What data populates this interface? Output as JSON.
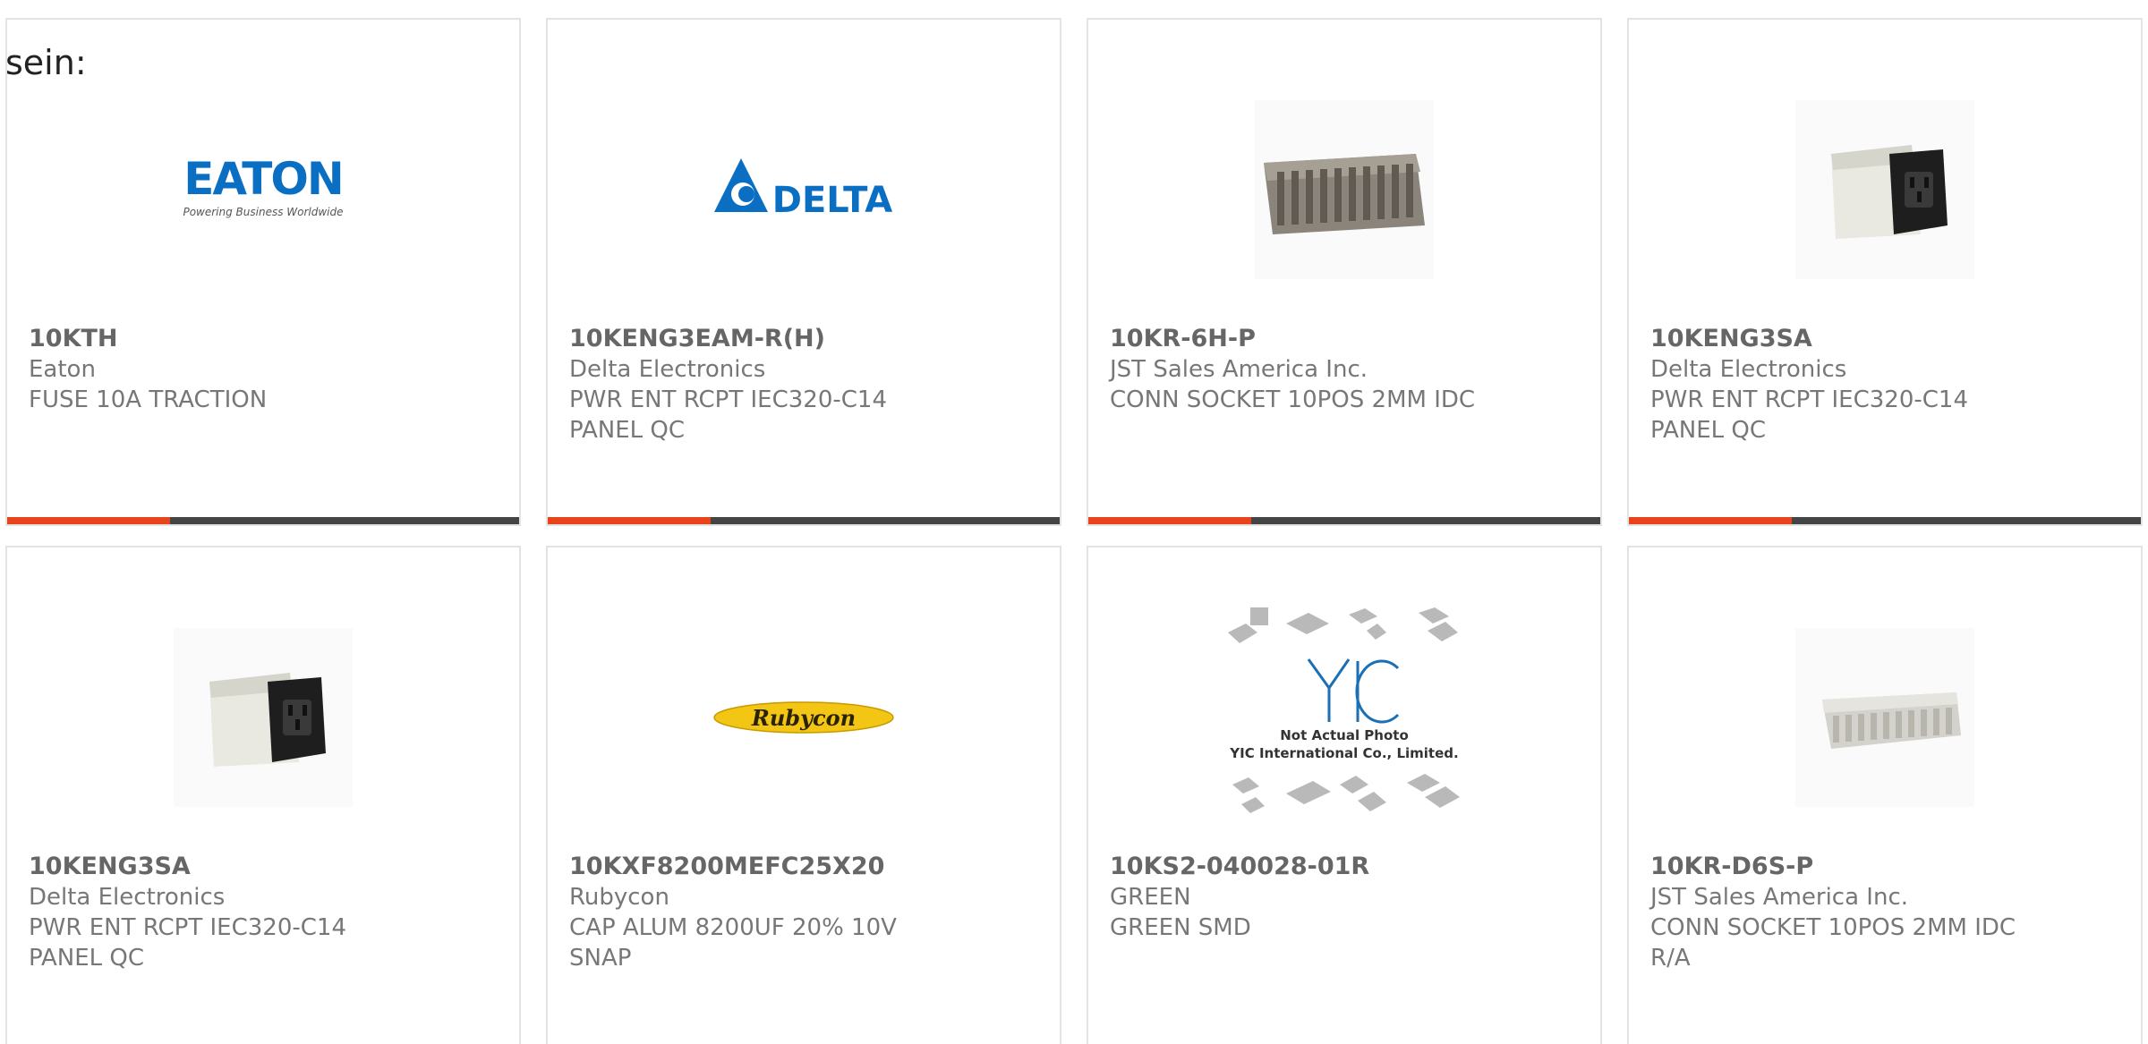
{
  "lead_text": "sein:",
  "colors": {
    "accent": "#e8441c",
    "bar": "#444444",
    "card_border": "#e3e3e3",
    "text": "#666666"
  },
  "cards": [
    {
      "part_number": "10KTH",
      "manufacturer": "Eaton",
      "description_lines": [
        "FUSE 10A TRACTION"
      ],
      "image": "eaton-logo",
      "logo_text": "EATON",
      "logo_tagline": "Powering Business Worldwide"
    },
    {
      "part_number": "10KENG3EAM-R(H)",
      "manufacturer": "Delta Electronics",
      "description_lines": [
        "PWR ENT RCPT IEC320-C14",
        "PANEL QC"
      ],
      "image": "delta-logo",
      "logo_text": "DELTA"
    },
    {
      "part_number": "10KR-6H-P",
      "manufacturer": "JST Sales America Inc.",
      "description_lines": [
        "CONN SOCKET 10POS 2MM IDC"
      ],
      "image": "idc-connector-photo"
    },
    {
      "part_number": "10KENG3SA",
      "manufacturer": "Delta Electronics",
      "description_lines": [
        "PWR ENT RCPT IEC320-C14",
        "PANEL QC"
      ],
      "image": "power-entry-module-photo"
    },
    {
      "part_number": "10KENG3SA",
      "manufacturer": "Delta Electronics",
      "description_lines": [
        "PWR ENT RCPT IEC320-C14",
        "PANEL QC"
      ],
      "image": "power-entry-module-photo"
    },
    {
      "part_number": "10KXF8200MEFC25X20",
      "manufacturer": "Rubycon",
      "description_lines": [
        "CAP ALUM 8200UF 20% 10V",
        "SNAP"
      ],
      "image": "rubycon-logo",
      "logo_text": "Rubycon"
    },
    {
      "part_number": "10KS2-040028-01R",
      "manufacturer": "GREEN",
      "description_lines": [
        "GREEN SMD"
      ],
      "image": "yic-placeholder",
      "logo_text": "YIC",
      "caption_line1": "Not Actual Photo",
      "caption_line2": "YIC International Co., Limited."
    },
    {
      "part_number": "10KR-D6S-P",
      "manufacturer": "JST Sales America Inc.",
      "description_lines": [
        "CONN SOCKET 10POS 2MM IDC",
        "R/A"
      ],
      "image": "ra-connector-photo"
    }
  ]
}
